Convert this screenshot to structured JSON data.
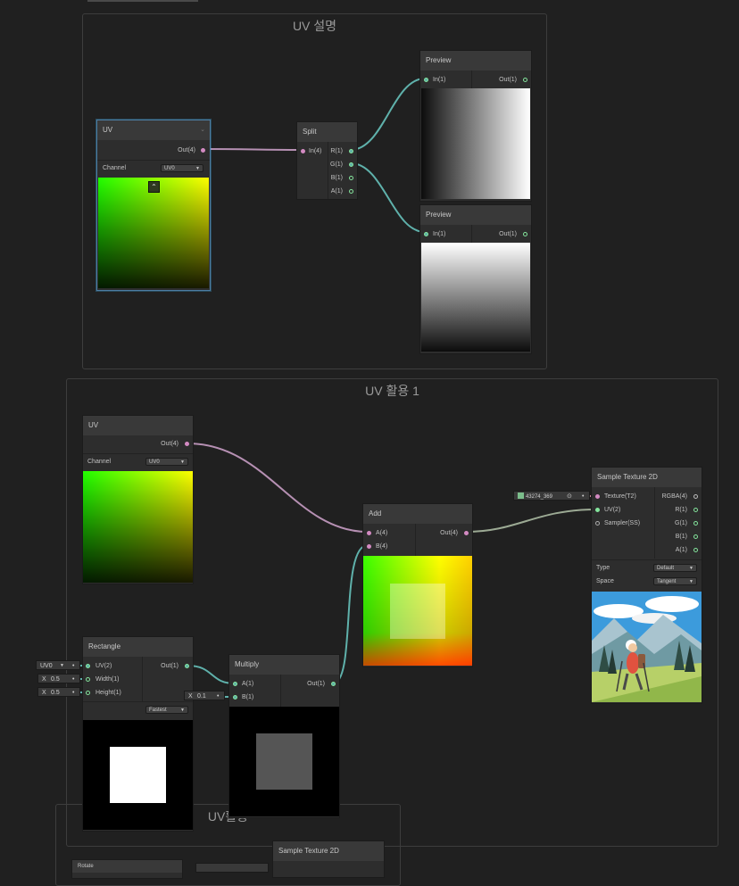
{
  "groups": {
    "uv_desc": {
      "title": "UV 설명"
    },
    "uv_use1": {
      "title": "UV 활용 1"
    },
    "uv_use2": {
      "title": "UV활용"
    }
  },
  "nodes": {
    "uv_top": {
      "title": "UV",
      "out": "Out(4)",
      "channel_label": "Channel",
      "channel_value": "UV0"
    },
    "split": {
      "title": "Split",
      "in": "In(4)",
      "outs": [
        "R(1)",
        "G(1)",
        "B(1)",
        "A(1)"
      ]
    },
    "preview1": {
      "title": "Preview",
      "in": "In(1)",
      "out": "Out(1)"
    },
    "preview2": {
      "title": "Preview",
      "in": "In(1)",
      "out": "Out(1)"
    },
    "uv_mid": {
      "title": "UV",
      "out": "Out(4)",
      "channel_label": "Channel",
      "channel_value": "UV0"
    },
    "add": {
      "title": "Add",
      "in_a": "A(4)",
      "in_b": "B(4)",
      "out": "Out(4)"
    },
    "sample": {
      "title": "Sample Texture 2D",
      "texture_value": "43274_369",
      "inputs": [
        "Texture(T2)",
        "UV(2)",
        "Sampler(SS)"
      ],
      "outputs": [
        "RGBA(4)",
        "R(1)",
        "G(1)",
        "B(1)",
        "A(1)"
      ],
      "type_label": "Type",
      "type_value": "Default",
      "space_label": "Space",
      "space_value": "Tangent"
    },
    "rectangle": {
      "title": "Rectangle",
      "inputs": [
        "UV(2)",
        "Width(1)",
        "Height(1)"
      ],
      "out": "Out(1)",
      "quality_value": "Fastest",
      "uv_field": "UV0",
      "width_axis": "X",
      "width_value": "0.5",
      "height_axis": "X",
      "height_value": "0.5"
    },
    "multiply": {
      "title": "Multiply",
      "in_a": "A(1)",
      "in_b": "B(1)",
      "out": "Out(1)",
      "b_axis": "X",
      "b_value": "0.1"
    },
    "sample_bottom": {
      "title": "Sample Texture 2D"
    },
    "rotate_bottom": {
      "title": "Rotate"
    }
  }
}
